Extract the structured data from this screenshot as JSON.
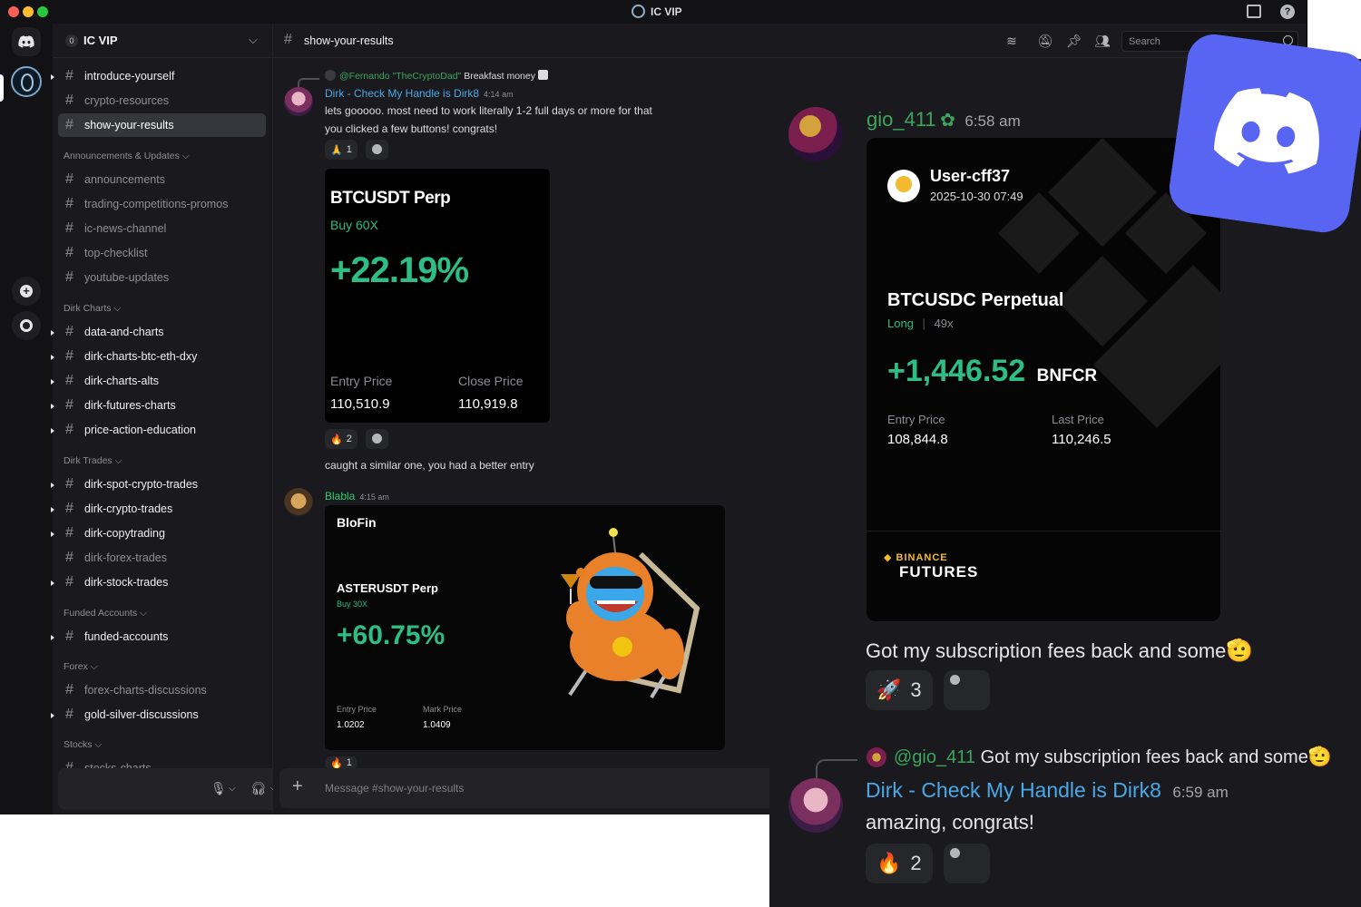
{
  "window": {
    "title": "IC VIP",
    "colors": {
      "accent_green": "#2ebd85",
      "link_blue": "#4aa8e8",
      "mention_green": "#3ba55c"
    }
  },
  "sidebar": {
    "server_name": "IC VIP",
    "server_badge": "0",
    "channels_top": [
      {
        "label": "introduce-yourself",
        "unread": true
      },
      {
        "label": "crypto-resources",
        "unread": false
      },
      {
        "label": "show-your-results",
        "unread": false,
        "active": true
      }
    ],
    "categories": [
      {
        "label": "Announcements & Updates",
        "channels": [
          "announcements",
          "trading-competitions-promos",
          "ic-news-channel",
          "top-checklist",
          "youtube-updates"
        ]
      },
      {
        "label": "Dirk Charts",
        "channels": [
          "data-and-charts",
          "dirk-charts-btc-eth-dxy",
          "dirk-charts-alts",
          "dirk-futures-charts",
          "price-action-education"
        ]
      },
      {
        "label": "Dirk Trades",
        "channels": [
          "dirk-spot-crypto-trades",
          "dirk-crypto-trades",
          "dirk-copytrading",
          "dirk-forex-trades",
          "dirk-stock-trades"
        ]
      },
      {
        "label": "Funded Accounts",
        "channels": [
          "funded-accounts"
        ]
      },
      {
        "label": "Forex",
        "channels": [
          "forex-charts-discussions",
          "gold-silver-discussions"
        ]
      },
      {
        "label": "Stocks",
        "channels": [
          "stocks-charts"
        ]
      }
    ]
  },
  "chat": {
    "channel": "show-your-results",
    "search_placeholder": "Search",
    "composer_placeholder": "Message #show-your-results",
    "reply_preview": {
      "mention": "@Fernando \"TheCryptoDad\"",
      "text": "Breakfast money"
    },
    "messages": [
      {
        "author": "Dirk - Check My Handle is Dirk8",
        "time": "4:14 am",
        "lines": [
          "lets gooooo. most need to work literally 1-2 full days or more for that",
          "you clicked a few buttons! congrats!"
        ],
        "reaction": {
          "emoji": "🙏",
          "count": "1"
        }
      },
      {
        "card": {
          "pair": "BTCUSDT Perp",
          "side": "Buy 60X",
          "pnl": "+22.19%",
          "entry_label": "Entry Price",
          "entry": "110,510.9",
          "close_label": "Close Price",
          "close": "110,919.8"
        },
        "reaction": {
          "emoji": "🔥",
          "count": "2"
        },
        "text": "caught a similar one, you had a better entry"
      },
      {
        "author": "Blabla",
        "time": "4:15 am",
        "card": {
          "brand": "BloFin",
          "pair": "ASTERUSDT Perp",
          "side": "Buy 30X",
          "pnl": "+60.75%",
          "entry_label": "Entry Price",
          "entry": "1.0202",
          "mark_label": "Mark Price",
          "mark": "1.0409"
        },
        "reaction": {
          "emoji": "🔥",
          "count": "1"
        }
      }
    ]
  },
  "overlay": {
    "author": "gio_411",
    "time": "6:58 am",
    "card": {
      "user": "User-cff37",
      "datetime": "2025-10-30 07:49",
      "pair": "BTCUSDC Perpetual",
      "side": "Long",
      "leverage": "49x",
      "pnl": "+1,446.52",
      "currency": "BNFCR",
      "entry_label": "Entry Price",
      "entry": "108,844.8",
      "last_label": "Last Price",
      "last": "110,246.5",
      "brand_top": "BINANCE",
      "brand_bottom": "FUTURES"
    },
    "message": "Got my subscription fees back and some",
    "reaction1": {
      "emoji": "🚀",
      "count": "3"
    },
    "reply": {
      "mention": "@gio_411",
      "quoted": "Got my subscription fees back and some",
      "author": "Dirk - Check My Handle is Dirk8",
      "time": "6:59 am",
      "text": "amazing, congrats!",
      "reaction": {
        "emoji": "🔥",
        "count": "2"
      }
    }
  }
}
